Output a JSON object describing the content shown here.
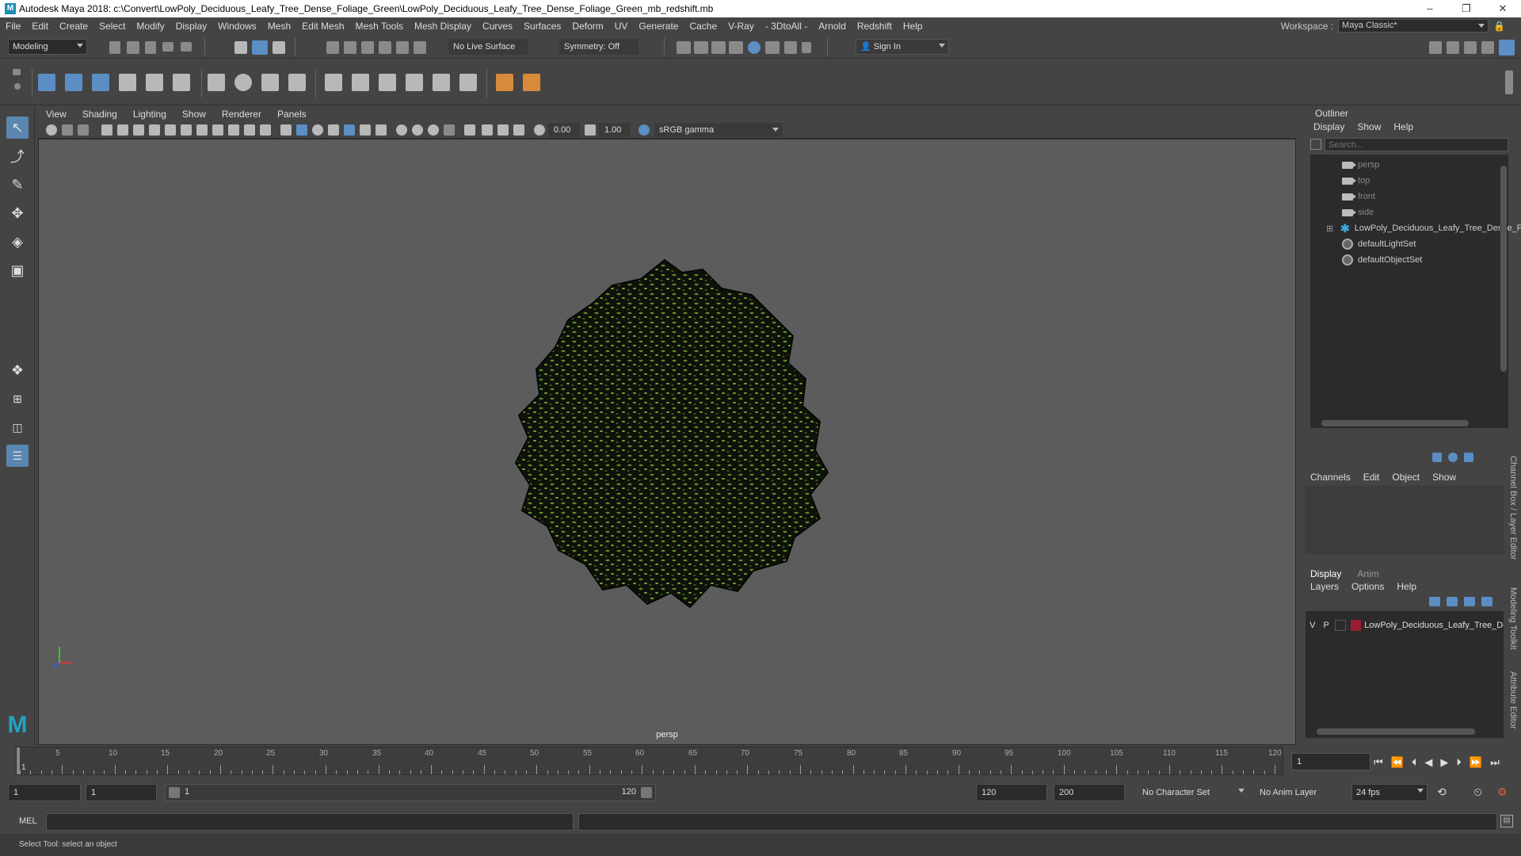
{
  "window": {
    "title": "Autodesk Maya 2018: c:\\Convert\\LowPoly_Deciduous_Leafy_Tree_Dense_Foliage_Green\\LowPoly_Deciduous_Leafy_Tree_Dense_Foliage_Green_mb_redshift.mb",
    "minimize": "–",
    "maximize": "❐",
    "close": "✕"
  },
  "menubar": {
    "items": [
      "File",
      "Edit",
      "Create",
      "Select",
      "Modify",
      "Display",
      "Windows",
      "Mesh",
      "Edit Mesh",
      "Mesh Tools",
      "Mesh Display",
      "Curves",
      "Surfaces",
      "Deform",
      "UV",
      "Generate",
      "Cache",
      "V-Ray",
      "- 3DtoAll -",
      "Arnold",
      "Redshift",
      "Help"
    ],
    "workspace_label": "Workspace :",
    "workspace_value": "Maya Classic*"
  },
  "statusline": {
    "mode": "Modeling",
    "live_surface": "No Live Surface",
    "symmetry": "Symmetry: Off",
    "sign_in": "Sign In"
  },
  "viewport": {
    "menu": [
      "View",
      "Shading",
      "Lighting",
      "Show",
      "Renderer",
      "Panels"
    ],
    "exposure": "0.00",
    "gamma": "1.00",
    "color_space": "sRGB gamma",
    "camera_label": "persp"
  },
  "outliner": {
    "title": "Outliner",
    "menu": [
      "Display",
      "Show",
      "Help"
    ],
    "search_placeholder": "Search...",
    "items": [
      {
        "label": "persp",
        "type": "camera"
      },
      {
        "label": "top",
        "type": "camera"
      },
      {
        "label": "front",
        "type": "camera"
      },
      {
        "label": "side",
        "type": "camera"
      },
      {
        "label": "LowPoly_Deciduous_Leafy_Tree_Dense_F",
        "type": "group"
      },
      {
        "label": "defaultLightSet",
        "type": "set"
      },
      {
        "label": "defaultObjectSet",
        "type": "set"
      }
    ]
  },
  "channelbox": {
    "menu": [
      "Channels",
      "Edit",
      "Object",
      "Show"
    ]
  },
  "layers": {
    "tabs": [
      "Display",
      "Anim"
    ],
    "menu": [
      "Layers",
      "Options",
      "Help"
    ],
    "layer": {
      "v": "V",
      "p": "P",
      "name": "LowPoly_Deciduous_Leafy_Tree_De",
      "color": "#9a1c2e"
    }
  },
  "side_tabs": [
    "Channel Box / Layer Editor",
    "Modeling Toolkit",
    "Attribute Editor"
  ],
  "timeline": {
    "ticks": [
      "5",
      "10",
      "15",
      "20",
      "25",
      "30",
      "35",
      "40",
      "45",
      "50",
      "55",
      "60",
      "65",
      "70",
      "75",
      "80",
      "85",
      "90",
      "95",
      "100",
      "105",
      "110",
      "115",
      "120"
    ],
    "current_marker": "1",
    "current_frame": "1"
  },
  "range": {
    "start": "1",
    "playback_start": "1",
    "slider_start": "1",
    "slider_end": "120",
    "playback_end": "120",
    "end": "200",
    "character_set": "No Character Set",
    "anim_layer": "No Anim Layer",
    "fps": "24 fps"
  },
  "command": {
    "label": "MEL"
  },
  "help_line": "Select Tool: select an object"
}
